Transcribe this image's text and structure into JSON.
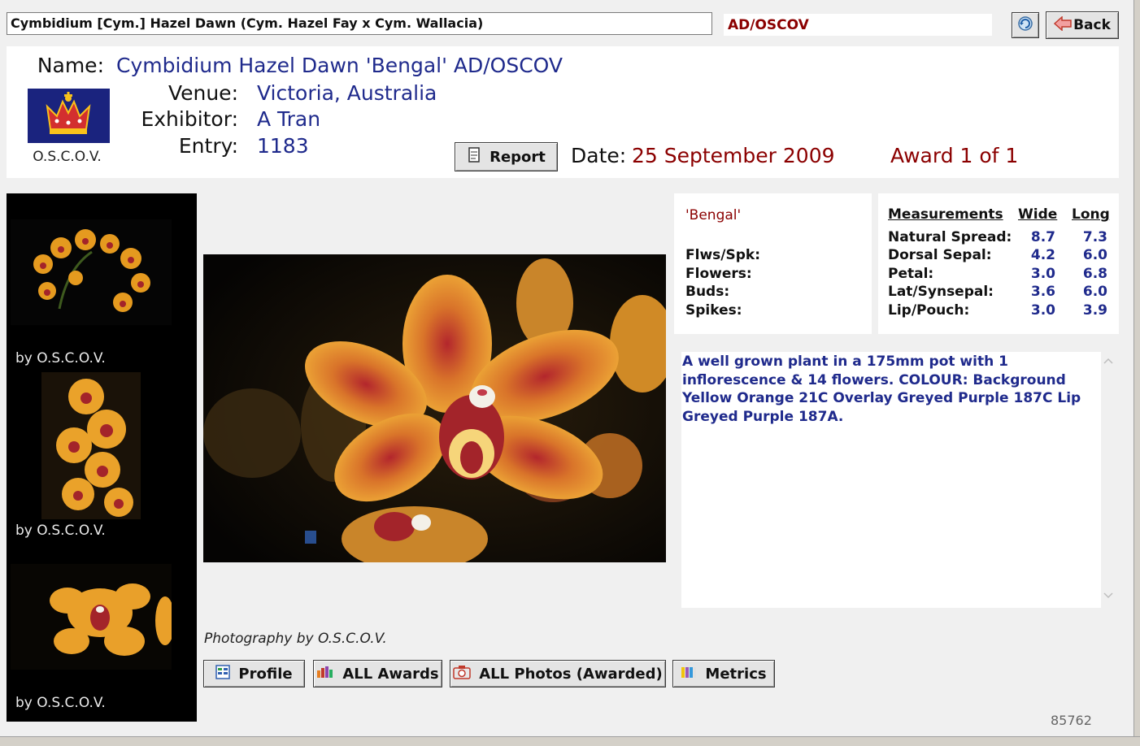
{
  "top_bar": {
    "plant_title": "Cymbidium [Cym.] Hazel Dawn (Cym. Hazel Fay x Cym. Wallacia)",
    "award_code": "AD/OSCOV",
    "back_label": "Back",
    "refresh_icon": "refresh-icon",
    "back_icon": "arrow-left-icon"
  },
  "header": {
    "name_label": "Name:",
    "name_value": "Cymbidium Hazel Dawn 'Bengal' AD/OSCOV",
    "venue_label": "Venue:",
    "venue_value": "Victoria, Australia",
    "exhibitor_label": "Exhibitor:",
    "exhibitor_value": "A Tran",
    "entry_label": "Entry:",
    "entry_value": "1183",
    "society_caption": "O.S.C.O.V.",
    "crest_icon": "crown-crest-icon",
    "report_label": "Report",
    "date_label": "Date:",
    "date_value": "25 September 2009",
    "award_count": "Award 1 of 1"
  },
  "thumbnails": [
    {
      "caption": "by O.S.C.O.V."
    },
    {
      "caption": "by O.S.C.O.V."
    },
    {
      "caption": "by O.S.C.O.V."
    }
  ],
  "photo_credit": "Photography by O.S.C.O.V.",
  "info": {
    "cultivar": "'Bengal'",
    "labels": [
      "Flws/Spk:",
      "Flowers:",
      "Buds:",
      "Spikes:"
    ]
  },
  "measurements": {
    "headers": {
      "title": "Measurements",
      "wide": "Wide",
      "long": "Long"
    },
    "rows": [
      {
        "label": "Natural Spread:",
        "wide": "8.7",
        "long": "7.3"
      },
      {
        "label": "Dorsal Sepal:",
        "wide": "4.2",
        "long": "6.0"
      },
      {
        "label": "Petal:",
        "wide": "3.0",
        "long": "6.8"
      },
      {
        "label": "Lat/Synsepal:",
        "wide": "3.6",
        "long": "6.0"
      },
      {
        "label": "Lip/Pouch:",
        "wide": "3.0",
        "long": "3.9"
      }
    ]
  },
  "description": "A well grown plant in a 175mm pot with 1 inflorescence & 14 flowers. COLOUR: Background Yellow Orange 21C Overlay Greyed Purple 187C Lip Greyed Purple 187A.",
  "buttons": {
    "profile": "Profile",
    "all_awards": "ALL Awards",
    "all_photos": "ALL Photos (Awarded)",
    "metrics": "Metrics"
  },
  "record_id": "85762",
  "colors": {
    "value_blue": "#1f2a8c",
    "date_red": "#8b0000",
    "panel_white": "#ffffff",
    "background": "#f0f0f0"
  }
}
